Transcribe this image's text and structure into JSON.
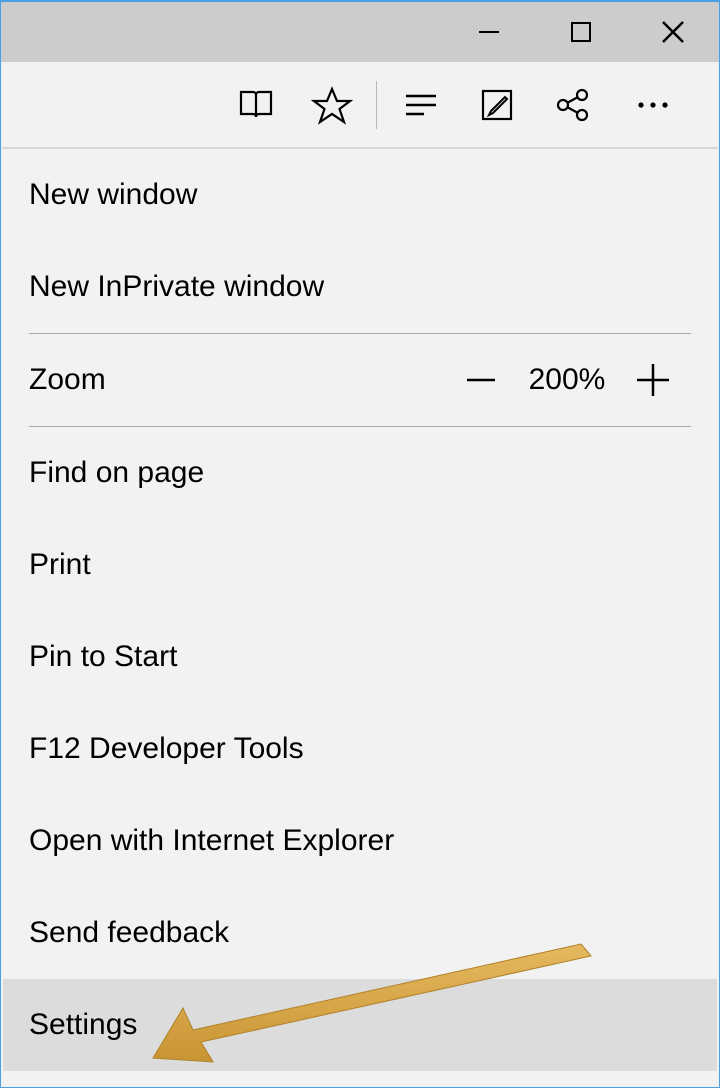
{
  "menu": {
    "new_window": "New window",
    "new_inprivate": "New InPrivate window",
    "zoom_label": "Zoom",
    "zoom_value": "200%",
    "find": "Find on page",
    "print": "Print",
    "pin": "Pin to Start",
    "devtools": "F12 Developer Tools",
    "open_ie": "Open with Internet Explorer",
    "feedback": "Send feedback",
    "settings": "Settings"
  }
}
